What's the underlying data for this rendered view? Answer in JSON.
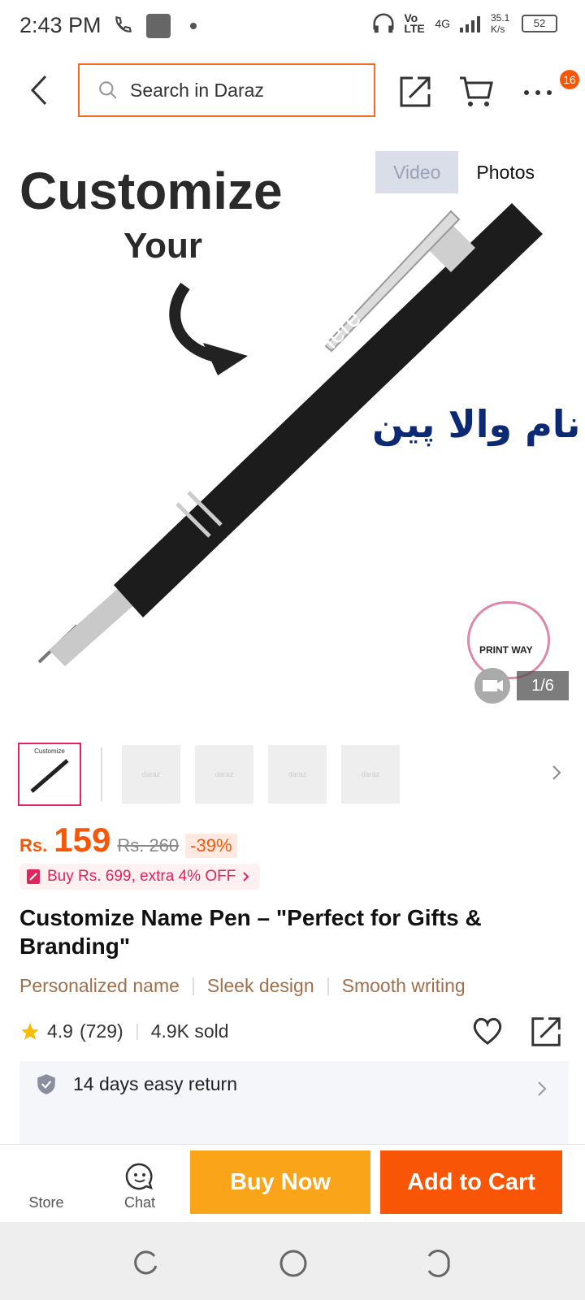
{
  "status_bar": {
    "time": "2:43 PM",
    "network": "Vo LTE",
    "signal": "4G",
    "speed": "35.1 K/s",
    "battery": "52"
  },
  "search": {
    "placeholder": "Search in Daraz"
  },
  "cart_badge": "16",
  "media": {
    "tab_video": "Video",
    "tab_photos": "Photos",
    "counter": "1/6"
  },
  "hero": {
    "headline_1": "Customize",
    "headline_2": "Your",
    "pen_text": "Name/Text Here",
    "urdu_text": "نام والا پین",
    "logo_text": "PRINT WAY"
  },
  "thumbnails": {
    "active_title": "Customize",
    "placeholder": "daraz"
  },
  "price": {
    "currency": "Rs.",
    "value": "159",
    "original": "Rs. 260",
    "discount": "-39%"
  },
  "promo": {
    "label": "Buy Rs. 699, extra 4% OFF"
  },
  "product": {
    "title": "Customize Name Pen – \"Perfect for Gifts & Branding\"",
    "features": [
      "Personalized name",
      "Sleek design",
      "Smooth writing"
    ]
  },
  "rating": {
    "score": "4.9",
    "count": "(729)",
    "sold": "4.9K sold"
  },
  "service": {
    "return_label": "14 days easy return"
  },
  "bottom_bar": {
    "store": "Store",
    "chat": "Chat",
    "buy_now": "Buy Now",
    "add_to_cart": "Add to Cart"
  },
  "colors": {
    "accent": "#f85606",
    "buy_now": "#faa41a",
    "promo": "#e0245e",
    "feature_text": "#a0704c"
  }
}
